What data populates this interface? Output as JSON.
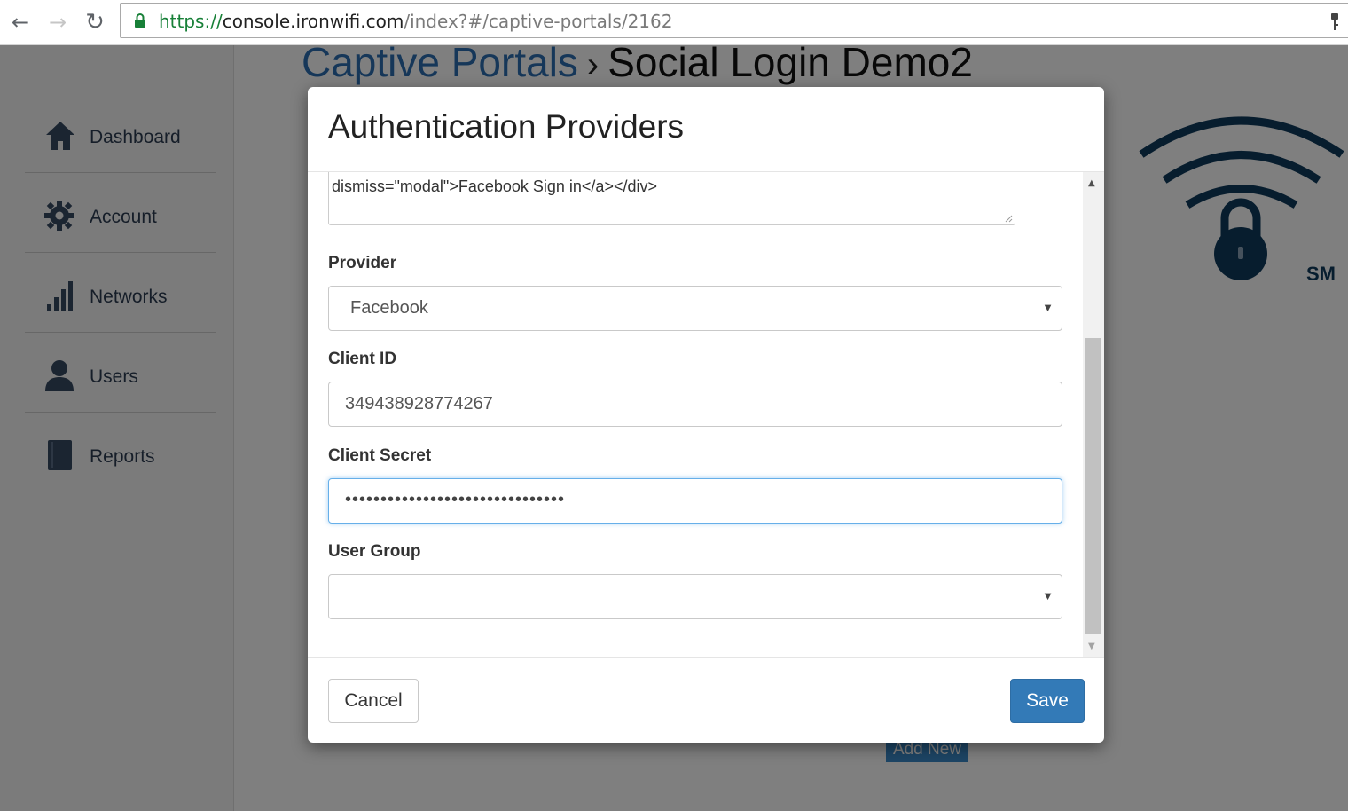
{
  "browser": {
    "url_scheme": "https://",
    "url_host": "console.ironwifi.com",
    "url_path": "/index?#/captive-portals/2162",
    "back_icon": "←",
    "forward_icon": "→",
    "reload_icon": "↻"
  },
  "sidebar": {
    "items": [
      {
        "label": "Dashboard",
        "icon": "home-icon"
      },
      {
        "label": "Account",
        "icon": "gear-icon"
      },
      {
        "label": "Networks",
        "icon": "bar-chart-icon"
      },
      {
        "label": "Users",
        "icon": "user-icon"
      },
      {
        "label": "Reports",
        "icon": "book-icon"
      }
    ]
  },
  "page": {
    "breadcrumb_parent": "Captive Portals",
    "breadcrumb_separator": "›",
    "title": "Social Login Demo2",
    "logo_text": "SM",
    "add_new_label": "Add New"
  },
  "modal": {
    "title": "Authentication Providers",
    "textarea_line": "dismiss=\"modal\">Facebook Sign in</a></div>",
    "provider": {
      "label": "Provider",
      "value": "Facebook"
    },
    "client_id": {
      "label": "Client ID",
      "value": "349438928774267"
    },
    "client_secret": {
      "label": "Client Secret",
      "value": "•••••••••••••••••••••••••••••••"
    },
    "user_group": {
      "label": "User Group",
      "value": ""
    },
    "cancel_label": "Cancel",
    "save_label": "Save"
  },
  "colors": {
    "link_blue": "#2c6fb3",
    "primary_button": "#337ab7",
    "sidebar_text": "#2d3d53",
    "logo_navy": "#0f3a5c"
  }
}
